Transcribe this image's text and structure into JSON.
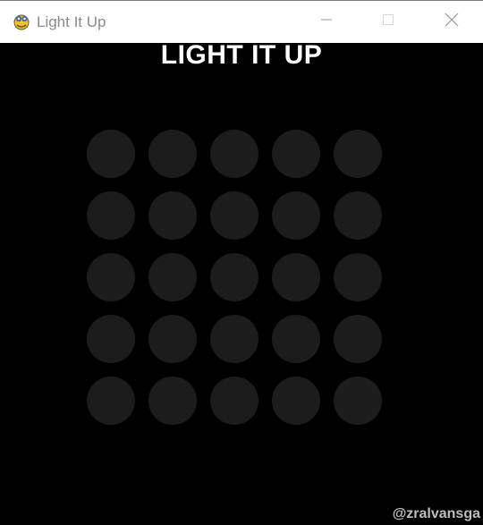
{
  "window": {
    "title": "Light It Up",
    "icon": "pygame-snake-icon",
    "controls": {
      "minimize_icon": "minimize-icon",
      "maximize_icon": "maximize-icon",
      "close_icon": "close-icon"
    }
  },
  "game": {
    "title": "LIGHT IT UP",
    "credit": "@zralvansga",
    "colors": {
      "background": "#000000",
      "light_off": "#1c1c1c",
      "light_on": "#f4e66a",
      "title": "#ffffff",
      "credit": "#bdbdbd"
    },
    "grid": {
      "rows": 5,
      "cols": 5,
      "cells": [
        [
          0,
          0,
          0,
          0,
          0
        ],
        [
          0,
          0,
          0,
          0,
          0
        ],
        [
          0,
          0,
          0,
          0,
          0
        ],
        [
          0,
          0,
          0,
          0,
          0
        ],
        [
          0,
          0,
          0,
          0,
          0
        ]
      ]
    }
  }
}
